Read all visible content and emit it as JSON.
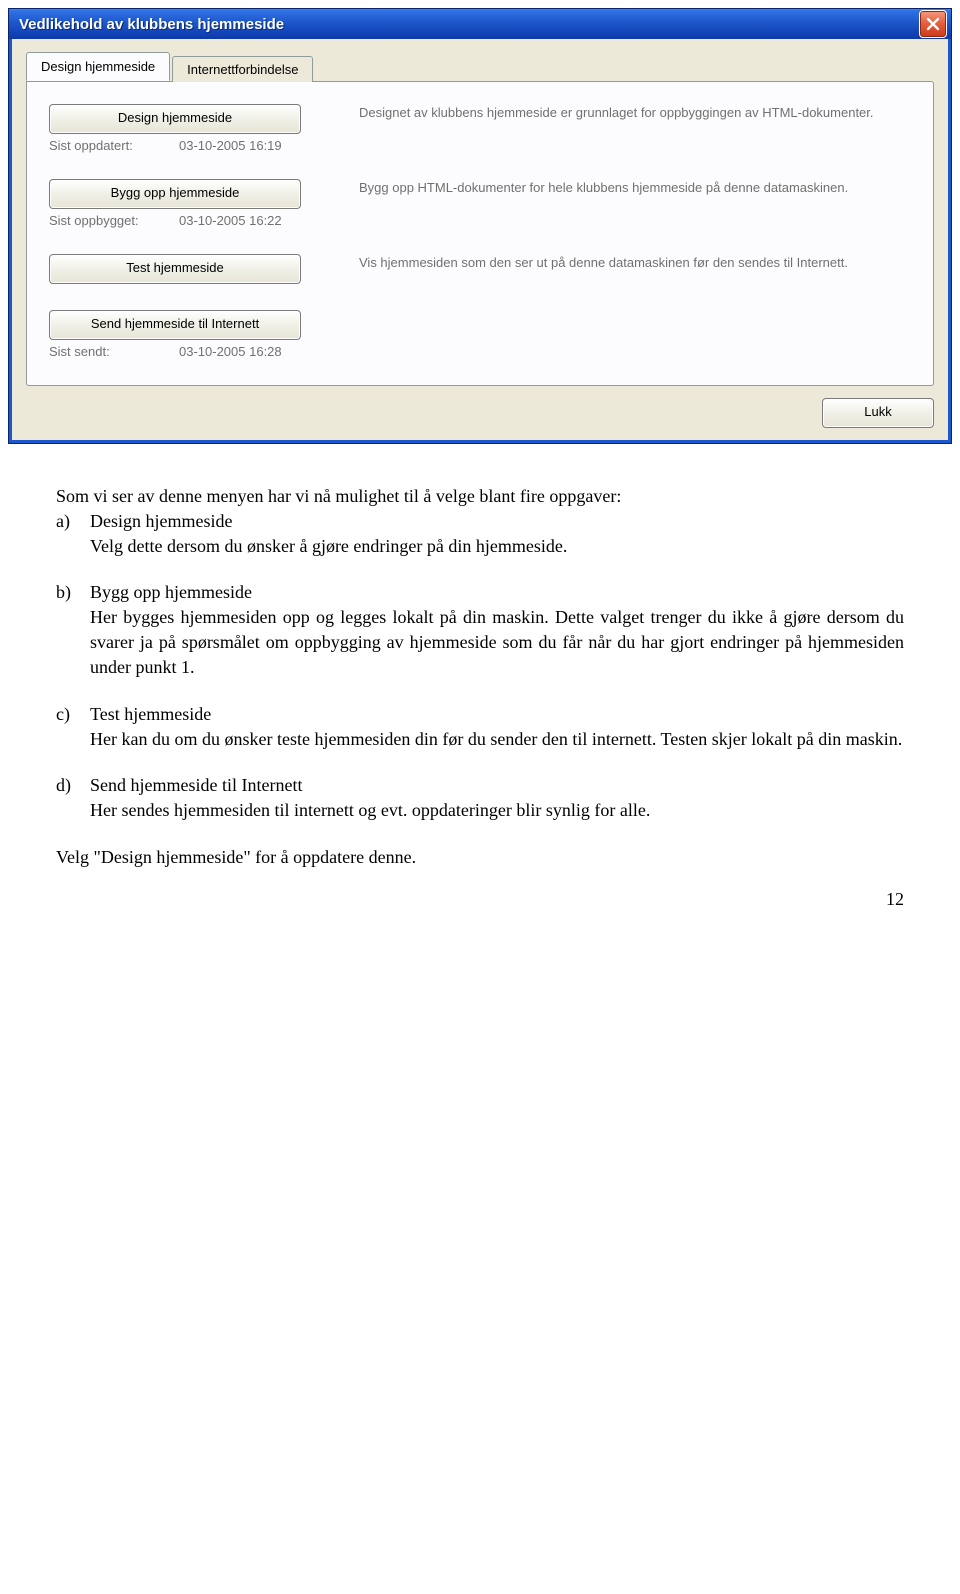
{
  "window": {
    "title": "Vedlikehold av klubbens hjemmeside",
    "tabs": [
      {
        "label": "Design hjemmeside",
        "active": true
      },
      {
        "label": "Internettforbindelse",
        "active": false
      }
    ],
    "rows": [
      {
        "button": "Design hjemmeside",
        "status_label": "Sist oppdatert:",
        "status_value": "03-10-2005 16:19",
        "description": "Designet av klubbens hjemmeside er grunnlaget for oppbyggingen av HTML-dokumenter."
      },
      {
        "button": "Bygg opp hjemmeside",
        "status_label": "Sist oppbygget:",
        "status_value": "03-10-2005 16:22",
        "description": "Bygg opp HTML-dokumenter for hele klubbens hjemmeside på denne datamaskinen."
      },
      {
        "button": "Test hjemmeside",
        "status_label": "",
        "status_value": "",
        "description": "Vis hjemmesiden som den ser ut på denne datamaskinen før den sendes til Internett."
      },
      {
        "button": "Send hjemmeside til Internett",
        "status_label": "Sist sendt:",
        "status_value": "03-10-2005 16:28",
        "description": ""
      }
    ],
    "close_button": "Lukk"
  },
  "doc": {
    "intro": "Som vi ser av denne menyen har vi nå mulighet til å velge blant fire oppgaver:",
    "items": [
      {
        "marker": "a)",
        "title": "Design hjemmeside",
        "body": "Velg dette dersom du ønsker å gjøre endringer på din hjemmeside."
      },
      {
        "marker": "b)",
        "title": "Bygg opp hjemmeside",
        "body": "Her bygges hjemmesiden opp og legges lokalt på din maskin. Dette valget trenger du ikke å gjøre dersom du svarer ja på spørsmålet om oppbygging av hjemmeside som du får når du har gjort endringer på hjemmesiden under punkt 1."
      },
      {
        "marker": "c)",
        "title": "Test hjemmeside",
        "body": "Her kan du om du ønsker teste hjemmesiden din før du sender den til internett. Testen skjer lokalt på din maskin."
      },
      {
        "marker": "d)",
        "title": "Send hjemmeside til Internett",
        "body": "Her sendes hjemmesiden til internett og evt. oppdateringer blir synlig for alle."
      }
    ],
    "outro": "Velg \"Design hjemmeside\" for å oppdatere denne.",
    "page_number": "12"
  }
}
